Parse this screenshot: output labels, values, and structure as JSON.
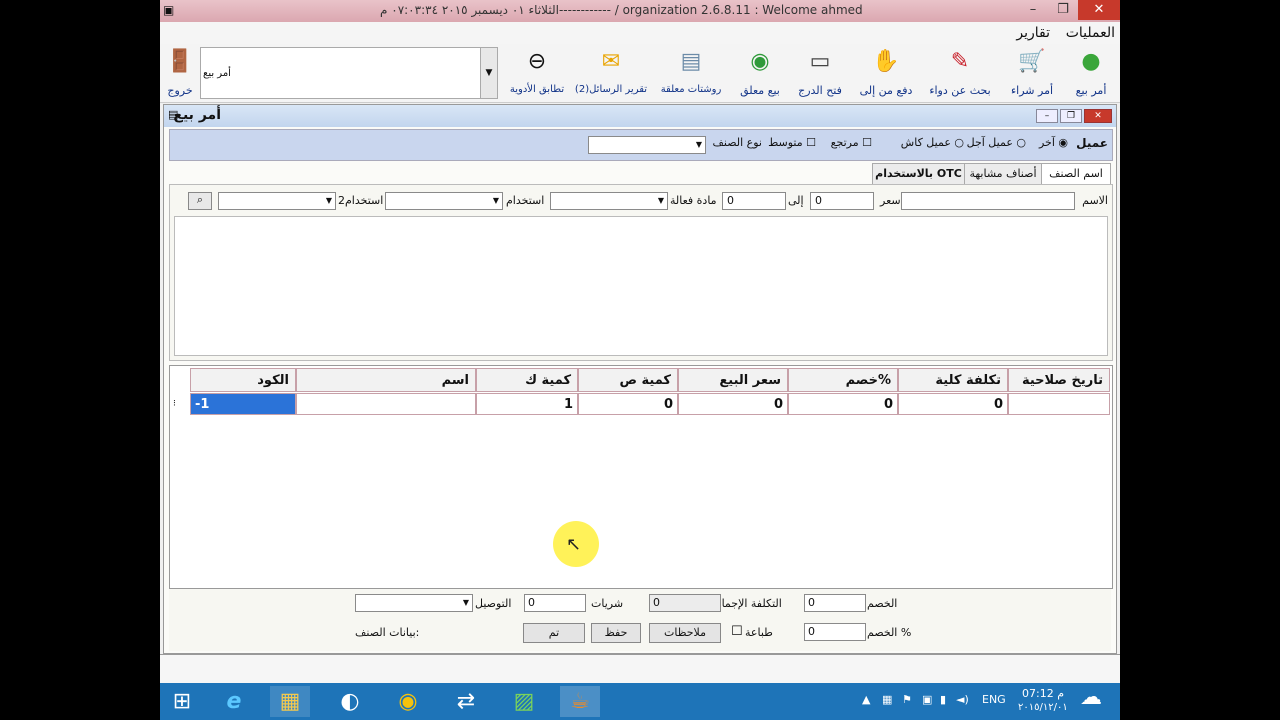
{
  "window": {
    "title": "الثلاثاء ٠١ ديسمبر ٢٠١٥ ٠٧:٠٣:٣٤ م------------ / organization    2.6.8.11 : Welcome ahmed",
    "controls": [
      "–",
      "❐",
      "✕"
    ]
  },
  "menu": {
    "operations": "العمليات",
    "reports": "تقارير"
  },
  "toolbar": {
    "items": [
      {
        "label": "أمر بيع",
        "icon": "sale-order-icon"
      },
      {
        "label": "أمر شراء",
        "icon": "purchase-cart-icon"
      },
      {
        "label": "بحث عن دواء",
        "icon": "search-drug-icon"
      },
      {
        "label": "دفع من إلى",
        "icon": "payment-icon"
      },
      {
        "label": "فتح الدرج",
        "icon": "drawer-icon"
      },
      {
        "label": "بيع معلق",
        "icon": "pending-sale-icon"
      },
      {
        "label": "روشتات معلقة",
        "icon": "prescriptions-icon"
      },
      {
        "label": "تقرير الرسائل(2)",
        "icon": "messages-icon"
      },
      {
        "label": "تطابق الأدوية",
        "icon": "drug-match-icon"
      }
    ],
    "combo_value": "أمر بيع",
    "exit_label": "خروج"
  },
  "child": {
    "title": "أمر بيع",
    "client_label": "عميل",
    "radio_other": "آخر",
    "radio_credit": "عميل آجل",
    "radio_cash": "عميل كاش",
    "chk_returned": "مرتجع",
    "chk_medium": "متوسط",
    "item_type_label": "نوع الصنف",
    "tabs": [
      "اسم الصنف",
      "أصناف مشابهة",
      "بالاستخدام OTC"
    ],
    "search": {
      "name_label": "الاسم",
      "price_label": "سعر",
      "price_from": "0",
      "to_label": "إلى",
      "price_to": "0",
      "active_label": "مادة فعالة",
      "usage_label": "استخدام",
      "usage2_label": "استخدام2"
    },
    "grid": {
      "headers": [
        "الكود",
        "اسم",
        "كمية ك",
        "كمية ص",
        "سعر البيع",
        "خصم%",
        "تكلفة كلية",
        "تاريخ صلاحية"
      ],
      "row": [
        "-1",
        "",
        "1",
        "0",
        "0",
        "0",
        "0",
        ""
      ]
    },
    "bottom": {
      "discount_label": "الخصم",
      "discount_value": "0",
      "discount_pct_label": "الخصم %",
      "discount_pct_value": "0",
      "total_cost_label": "التكلفة الإجمالية",
      "total_cost_value": "0",
      "strips_label": "شريات",
      "strips_value": "0",
      "delivery_label": "التوصيل",
      "print_label": "طباعة",
      "notes_button": "ملاحظات",
      "save_button": "حفظ",
      "done_button": "تم",
      "item_data_label": "بيانات الصنف:"
    }
  },
  "taskbar": {
    "lang": "ENG",
    "time": "07:12 م",
    "date": "٢٠١٥/١٢/٠١"
  }
}
